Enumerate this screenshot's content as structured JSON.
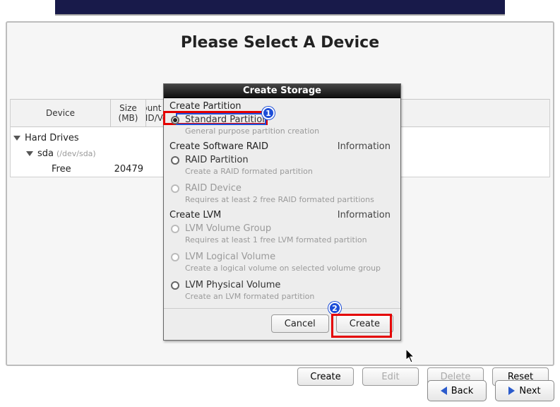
{
  "page_title": "Please Select A Device",
  "table": {
    "headers": {
      "device": "Device",
      "size": "Size\n(MB)",
      "mount": "Mount Point/\nRAID/Volume"
    },
    "rows": {
      "hard_drives": "Hard Drives",
      "sda_name": "sda",
      "sda_path": "(/dev/sda)",
      "free_label": "Free",
      "free_size": "20479"
    }
  },
  "dialog": {
    "title": "Create Storage",
    "sections": {
      "create_partition": "Create Partition",
      "create_raid": "Create Software RAID",
      "create_lvm": "Create LVM",
      "information": "Information"
    },
    "options": {
      "standard": {
        "label": "Standard Partition",
        "hint": "General purpose partition creation"
      },
      "raid_partition": {
        "label": "RAID Partition",
        "hint": "Create a RAID formated partition"
      },
      "raid_device": {
        "label": "RAID Device",
        "hint": "Requires at least 2 free RAID formated partitions"
      },
      "lvm_vg": {
        "label": "LVM Volume Group",
        "hint": "Requires at least 1 free LVM formated partition"
      },
      "lvm_lv": {
        "label": "LVM Logical Volume",
        "hint": "Create a logical volume on selected volume group"
      },
      "lvm_pv": {
        "label": "LVM Physical Volume",
        "hint": "Create an LVM formated partition"
      }
    },
    "buttons": {
      "cancel": "Cancel",
      "create": "Create"
    }
  },
  "main_buttons": {
    "create": "Create",
    "edit": "Edit",
    "delete": "Delete",
    "reset": "Reset"
  },
  "nav": {
    "back": "Back",
    "next": "Next"
  },
  "annotations": {
    "badge1": "1",
    "badge2": "2"
  }
}
